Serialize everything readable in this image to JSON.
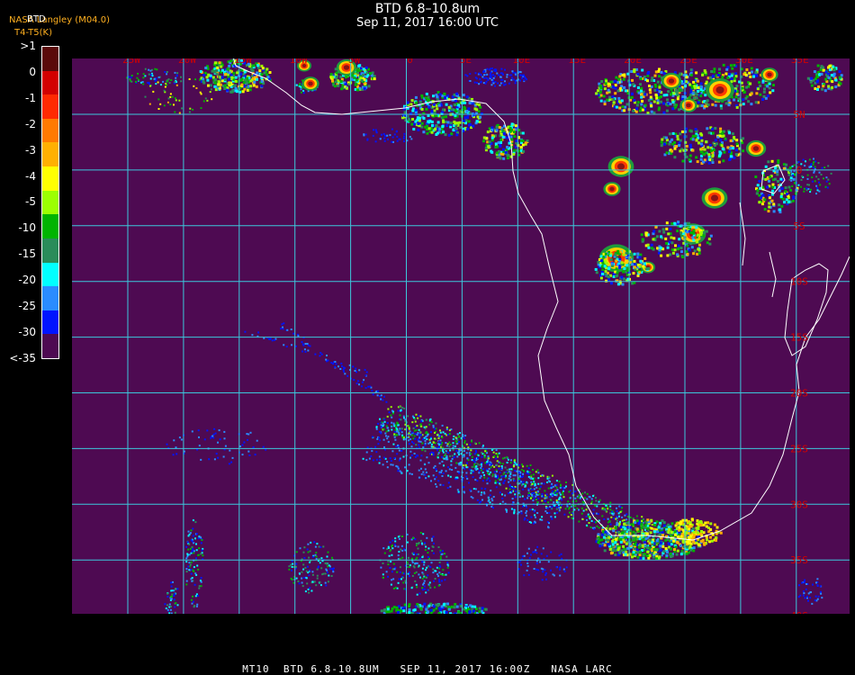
{
  "header": {
    "title": "BTD 6.8–10.8um",
    "subtitle": "Sep 11, 2017 16:00 UTC",
    "credit": "NASA Langley (M04.0)",
    "btd_tag": "BTD",
    "units": "T4-T5(K)"
  },
  "legend": {
    "labels": [
      ">1",
      "0",
      "-1",
      "-2",
      "-3",
      "-4",
      "-5",
      "-10",
      "-15",
      "-20",
      "-25",
      "-30",
      "<-35"
    ],
    "colors": [
      "#5a0a0a",
      "#d20000",
      "#ff2a00",
      "#ff7a00",
      "#ffb000",
      "#ffff00",
      "#9cff00",
      "#00b400",
      "#2a8c5a",
      "#00ffff",
      "#2a8cff",
      "#0014ff",
      "#4e0a52"
    ]
  },
  "map": {
    "longitude_labels": [
      "25W",
      "20W",
      "15W",
      "10W",
      "5W",
      "0",
      "5E",
      "10E",
      "15E",
      "20E",
      "25E",
      "30E",
      "35E"
    ],
    "latitude_labels": [
      "5N",
      "0",
      "5S",
      "10S",
      "15S",
      "20S",
      "25S",
      "30S",
      "35S",
      "40S"
    ],
    "background_color": "#4e0a52",
    "grid_color": "#3cc8dc",
    "coast_color": "#ffffff",
    "label_color": "#d20000"
  },
  "footer": {
    "text": "MT10  BTD 6.8-10.8UM   SEP 11, 2017 16:00Z   NASA LARC"
  }
}
